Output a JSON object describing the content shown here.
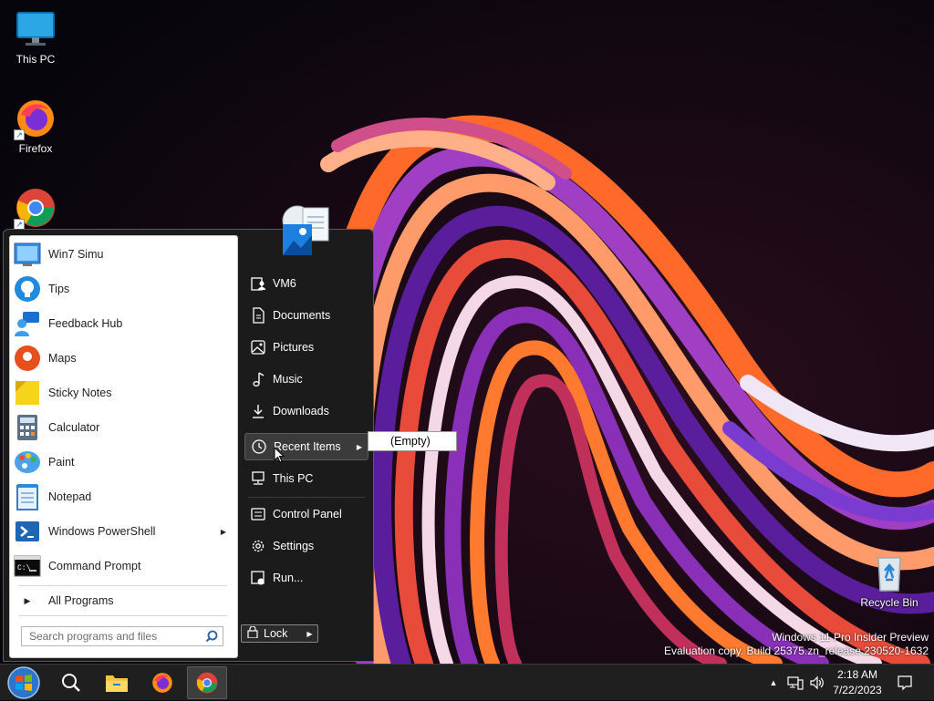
{
  "desktop": {
    "icons": [
      {
        "label": "This PC",
        "icon": "monitor-icon"
      },
      {
        "label": "Firefox",
        "icon": "firefox-icon"
      },
      {
        "label": "Chrome",
        "icon": "chrome-icon"
      },
      {
        "label": "Recycle Bin",
        "icon": "recycle-bin-icon"
      }
    ]
  },
  "watermark": {
    "line1": "Windows 11 Pro Insider Preview",
    "line2": "Evaluation copy. Build 25375.zn_release.230520-1632"
  },
  "start_menu": {
    "programs": [
      {
        "label": "Win7 Simu",
        "icon": "win7-simu-icon"
      },
      {
        "label": "Tips",
        "icon": "tips-icon"
      },
      {
        "label": "Feedback Hub",
        "icon": "feedback-hub-icon"
      },
      {
        "label": "Maps",
        "icon": "maps-icon"
      },
      {
        "label": "Sticky Notes",
        "icon": "sticky-notes-icon"
      },
      {
        "label": "Calculator",
        "icon": "calculator-icon"
      },
      {
        "label": "Paint",
        "icon": "paint-icon"
      },
      {
        "label": "Notepad",
        "icon": "notepad-icon"
      },
      {
        "label": "Windows PowerShell",
        "icon": "powershell-icon",
        "has_submenu": true
      },
      {
        "label": "Command Prompt",
        "icon": "command-prompt-icon"
      }
    ],
    "all_programs": "All Programs",
    "search_placeholder": "Search programs and files",
    "right_items": [
      {
        "label": "VM6",
        "icon": "user-folder-icon"
      },
      {
        "label": "Documents",
        "icon": "document-icon"
      },
      {
        "label": "Pictures",
        "icon": "picture-icon"
      },
      {
        "label": "Music",
        "icon": "music-icon"
      },
      {
        "label": "Downloads",
        "icon": "download-icon"
      },
      {
        "label": "Recent Items",
        "icon": "clock-icon",
        "has_submenu": true,
        "highlighted": true
      },
      {
        "label": "This PC",
        "icon": "computer-icon"
      },
      {
        "label": "Control Panel",
        "icon": "control-panel-icon"
      },
      {
        "label": "Settings",
        "icon": "gear-icon"
      },
      {
        "label": "Run...",
        "icon": "run-icon"
      }
    ],
    "lock_label": "Lock",
    "recent_submenu": {
      "item": "(Empty)"
    }
  },
  "taskbar": {
    "pinned": [
      "start-orb",
      "search",
      "file-explorer",
      "firefox",
      "chrome"
    ],
    "clock": {
      "time": "2:18 AM",
      "date": "7/22/2023"
    }
  }
}
